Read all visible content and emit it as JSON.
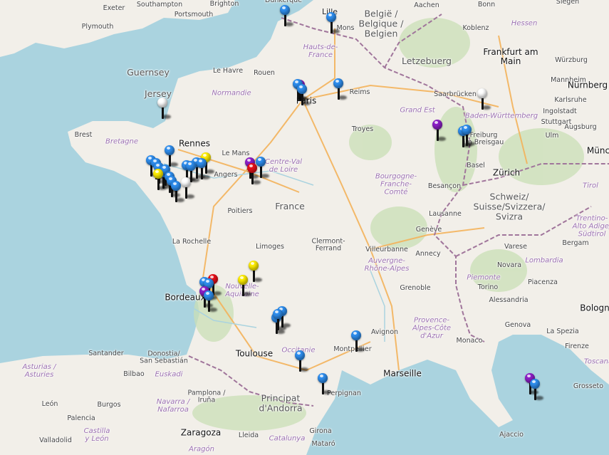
{
  "map": {
    "colors": {
      "sea": "#aad3df",
      "land": "#f2efe9",
      "border": "#a0759b",
      "road": "#f4b35b",
      "forest": "#c9dfb5",
      "pin_blue": "#2f8ff0",
      "pin_white": "#ffffff",
      "pin_yellow": "#ffee00",
      "pin_red": "#e8101a",
      "pin_purple": "#8e1fc9"
    },
    "labels": [
      {
        "text": "Exeter",
        "kind": "small"
      },
      {
        "text": "Southampton",
        "kind": "small"
      },
      {
        "text": "Portsmouth",
        "kind": "small"
      },
      {
        "text": "Brighton",
        "kind": "small"
      },
      {
        "text": "Dunkerque",
        "kind": "small"
      },
      {
        "text": "Lille",
        "kind": "city"
      },
      {
        "text": "Mons",
        "kind": "small"
      },
      {
        "text": "België /\nBelgique /\nBelgien",
        "kind": "country"
      },
      {
        "text": "Aachen",
        "kind": "small"
      },
      {
        "text": "Bonn",
        "kind": "small"
      },
      {
        "text": "Siegen",
        "kind": "small"
      },
      {
        "text": "Plymouth",
        "kind": "small"
      },
      {
        "text": "Koblenz",
        "kind": "small"
      },
      {
        "text": "Hessen",
        "kind": "region"
      },
      {
        "text": "Frankfurt am\nMain",
        "kind": "big"
      },
      {
        "text": "Hauts-de-\nFrance",
        "kind": "region"
      },
      {
        "text": "Letzebuerg",
        "kind": "country"
      },
      {
        "text": "Würzburg",
        "kind": "small"
      },
      {
        "text": "Guernsey",
        "kind": "country"
      },
      {
        "text": "Le Havre",
        "kind": "small"
      },
      {
        "text": "Rouen",
        "kind": "small"
      },
      {
        "text": "Mannheim",
        "kind": "small"
      },
      {
        "text": "Jersey",
        "kind": "country"
      },
      {
        "text": "Normandie",
        "kind": "region"
      },
      {
        "text": "Paris",
        "kind": "big"
      },
      {
        "text": "Reims",
        "kind": "small"
      },
      {
        "text": "Saarbrücken",
        "kind": "small"
      },
      {
        "text": "Karlsruhe",
        "kind": "small"
      },
      {
        "text": "Nürnberg",
        "kind": "big"
      },
      {
        "text": "Ingolstadt",
        "kind": "small"
      },
      {
        "text": "Grand Est",
        "kind": "region"
      },
      {
        "text": "Stuttgart",
        "kind": "small"
      },
      {
        "text": "Baden-Württemberg",
        "kind": "region"
      },
      {
        "text": "Brest",
        "kind": "small"
      },
      {
        "text": "Troyes",
        "kind": "small"
      },
      {
        "text": "Augsburg",
        "kind": "small"
      },
      {
        "text": "Rennes",
        "kind": "big"
      },
      {
        "text": "Freiburg\nim Breisgau",
        "kind": "small"
      },
      {
        "text": "Ulm",
        "kind": "small"
      },
      {
        "text": "Bretagne",
        "kind": "region"
      },
      {
        "text": "Le Mans",
        "kind": "small"
      },
      {
        "text": "Münc",
        "kind": "big"
      },
      {
        "text": "Centre-Val\nde Loire",
        "kind": "region"
      },
      {
        "text": "Angers",
        "kind": "small"
      },
      {
        "text": "Basel",
        "kind": "small"
      },
      {
        "text": "Zürich",
        "kind": "big"
      },
      {
        "text": "Bourgogne-\nFranche-\nComté",
        "kind": "region"
      },
      {
        "text": "Tirol",
        "kind": "region"
      },
      {
        "text": "Besançon",
        "kind": "small"
      },
      {
        "text": "Schweiz/\nSuisse/Svizzera/\nSvizra",
        "kind": "country"
      },
      {
        "text": "France",
        "kind": "country"
      },
      {
        "text": "Poitiers",
        "kind": "small"
      },
      {
        "text": "Lausanne",
        "kind": "small"
      },
      {
        "text": "Trentino-\nAlto Adige/\nSüdtirol",
        "kind": "region"
      },
      {
        "text": "Genève",
        "kind": "small"
      },
      {
        "text": "La Rochelle",
        "kind": "small"
      },
      {
        "text": "Limoges",
        "kind": "small"
      },
      {
        "text": "Clermont-\nFerrand",
        "kind": "small"
      },
      {
        "text": "Villeurbanne",
        "kind": "small"
      },
      {
        "text": "Annecy",
        "kind": "small"
      },
      {
        "text": "Varese",
        "kind": "small"
      },
      {
        "text": "Bergam",
        "kind": "small"
      },
      {
        "text": "Novara",
        "kind": "small"
      },
      {
        "text": "Auvergne-\nRhône-Alpes",
        "kind": "region"
      },
      {
        "text": "Lombardia",
        "kind": "region"
      },
      {
        "text": "Piemonte",
        "kind": "region"
      },
      {
        "text": "Nouvelle-\nAquitaine",
        "kind": "region"
      },
      {
        "text": "Torino",
        "kind": "small"
      },
      {
        "text": "Piacenza",
        "kind": "small"
      },
      {
        "text": "Bordeaux",
        "kind": "big"
      },
      {
        "text": "Grenoble",
        "kind": "small"
      },
      {
        "text": "Alessandria",
        "kind": "small"
      },
      {
        "text": "Bologn",
        "kind": "big"
      },
      {
        "text": "Provence-\nAlpes-Côte\nd'Azur",
        "kind": "region"
      },
      {
        "text": "Genova",
        "kind": "small"
      },
      {
        "text": "Avignon",
        "kind": "small"
      },
      {
        "text": "La Spezia",
        "kind": "small"
      },
      {
        "text": "Monaco",
        "kind": "small"
      },
      {
        "text": "Firenze",
        "kind": "small"
      },
      {
        "text": "Toulouse",
        "kind": "big"
      },
      {
        "text": "Occitanie",
        "kind": "region"
      },
      {
        "text": "Montpellier",
        "kind": "small"
      },
      {
        "text": "Santander",
        "kind": "small"
      },
      {
        "text": "Donostia/\nSan Sebastián",
        "kind": "small"
      },
      {
        "text": "Toscana",
        "kind": "region"
      },
      {
        "text": "Marseille",
        "kind": "big"
      },
      {
        "text": "Asturias /\nAsturies",
        "kind": "region"
      },
      {
        "text": "Bilbao",
        "kind": "small"
      },
      {
        "text": "Euskadi",
        "kind": "region"
      },
      {
        "text": "Grosseto",
        "kind": "small"
      },
      {
        "text": "Perpignan",
        "kind": "small"
      },
      {
        "text": "Principat\nd'Andorra",
        "kind": "country"
      },
      {
        "text": "Pamplona /\nIruña",
        "kind": "small"
      },
      {
        "text": "Navarra /\nNafarroa",
        "kind": "region"
      },
      {
        "text": "León",
        "kind": "small"
      },
      {
        "text": "Burgos",
        "kind": "small"
      },
      {
        "text": "Palencia",
        "kind": "small"
      },
      {
        "text": "Castilla\ny León",
        "kind": "region"
      },
      {
        "text": "Valladolid",
        "kind": "small"
      },
      {
        "text": "Zaragoza",
        "kind": "big"
      },
      {
        "text": "Lleida",
        "kind": "small"
      },
      {
        "text": "Catalunya",
        "kind": "region"
      },
      {
        "text": "Girona",
        "kind": "small"
      },
      {
        "text": "Ajaccio",
        "kind": "small"
      },
      {
        "text": "Mataró",
        "kind": "small"
      },
      {
        "text": "Aragón",
        "kind": "region"
      }
    ],
    "markers": [
      {
        "color": "blue"
      },
      {
        "color": "blue"
      },
      {
        "color": "white"
      },
      {
        "color": "blue"
      },
      {
        "color": "purple"
      },
      {
        "color": "blue"
      },
      {
        "color": "blue"
      },
      {
        "color": "white"
      },
      {
        "color": "purple"
      },
      {
        "color": "blue"
      },
      {
        "color": "blue"
      },
      {
        "color": "blue"
      },
      {
        "color": "blue"
      },
      {
        "color": "blue"
      },
      {
        "color": "blue"
      },
      {
        "color": "blue"
      },
      {
        "color": "blue"
      },
      {
        "color": "yellow"
      },
      {
        "color": "blue"
      },
      {
        "color": "blue"
      },
      {
        "color": "blue"
      },
      {
        "color": "blue"
      },
      {
        "color": "blue"
      },
      {
        "color": "yellow"
      },
      {
        "color": "blue"
      },
      {
        "color": "white"
      },
      {
        "color": "purple"
      },
      {
        "color": "blue"
      },
      {
        "color": "red"
      },
      {
        "color": "yellow"
      },
      {
        "color": "yellow"
      },
      {
        "color": "red"
      },
      {
        "color": "blue"
      },
      {
        "color": "blue"
      },
      {
        "color": "purple"
      },
      {
        "color": "blue"
      },
      {
        "color": "blue"
      },
      {
        "color": "blue"
      },
      {
        "color": "blue"
      },
      {
        "color": "blue"
      },
      {
        "color": "blue"
      },
      {
        "color": "blue"
      },
      {
        "color": "purple"
      },
      {
        "color": "blue"
      },
      {
        "color": "blue"
      }
    ]
  }
}
